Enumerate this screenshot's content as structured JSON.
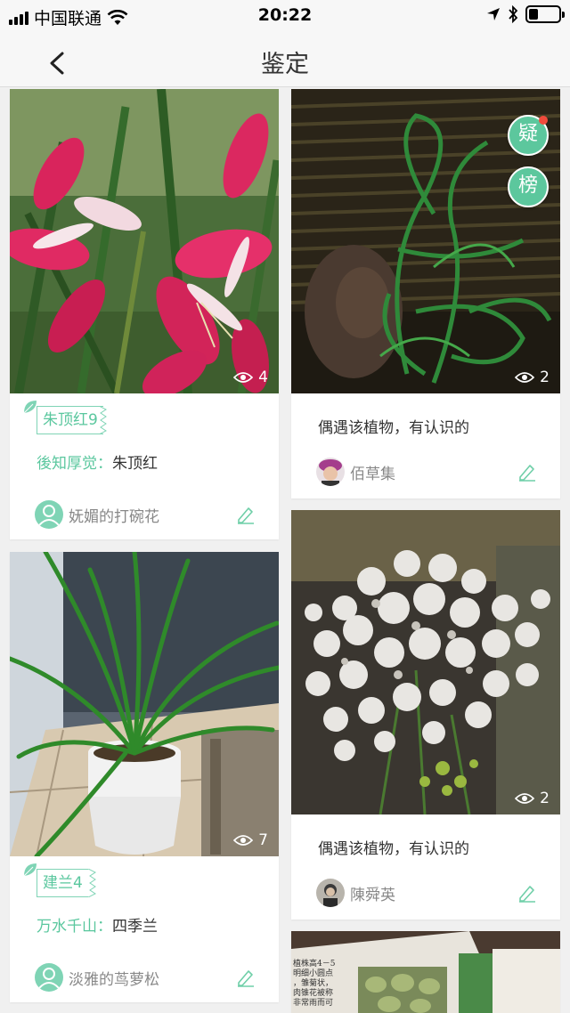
{
  "status_bar": {
    "carrier": "中国联通",
    "time": "20:22"
  },
  "nav": {
    "title": "鉴定",
    "back_icon": "chevron-left-icon"
  },
  "float_buttons": [
    {
      "label": "疑",
      "icon": "question-badge",
      "has_notification": true
    },
    {
      "label": "榜",
      "icon": "ranking-badge",
      "has_notification": false
    }
  ],
  "cards": [
    {
      "views": "4",
      "tag": "朱顶红9",
      "identifier": "後知厚觉",
      "identified_as": "朱顶红",
      "user": "妩媚的打碗花"
    },
    {
      "views": "2",
      "question": "偶遇该植物，有认识的",
      "user": "佰草集"
    },
    {
      "views": "7",
      "tag": "建兰4",
      "identifier": "万水千山",
      "identified_as": "四季兰",
      "user": "淡雅的茑萝松"
    },
    {
      "views": "2",
      "question": "偶遇该植物，有认识的",
      "user": "陳舜英"
    }
  ],
  "book_text": [
    "植株高4－5",
    "明细小圆点",
    "，雏菊状，",
    "肉锥花被称",
    "非常雨而可"
  ],
  "colors": {
    "accent": "#5ac79e",
    "float_button": "#5cc79d",
    "notification": "#f04b3c"
  },
  "separator": "："
}
